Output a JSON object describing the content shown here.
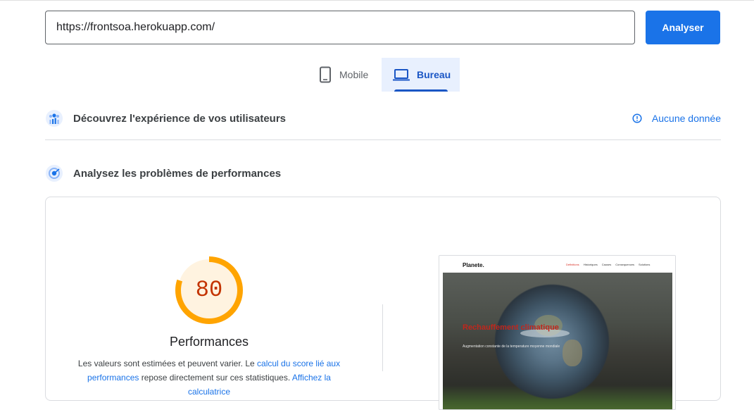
{
  "search": {
    "url_value": "https://frontsoa.herokuapp.com/",
    "analyze_label": "Analyser"
  },
  "tabs": [
    {
      "label": "Mobile",
      "icon": "smartphone-icon",
      "selected": false
    },
    {
      "label": "Bureau",
      "icon": "laptop-icon",
      "selected": true
    }
  ],
  "sections": {
    "field_data": {
      "title": "Découvrez l'expérience de vos utilisateurs",
      "icon": "users-data-icon",
      "status": "Aucune donnée",
      "status_icon": "info-icon"
    },
    "lab_data": {
      "title": "Analysez les problèmes de performances",
      "icon": "performance-diagnose-icon"
    }
  },
  "performance": {
    "score": "80",
    "score_fraction": 0.8,
    "label": "Performances",
    "desc_part1": "Les valeurs sont estimées et peuvent varier. Le ",
    "desc_link1": "calcul du score lié aux performances",
    "desc_part2": " repose directement sur ces statistiques. ",
    "desc_link2": "Affichez la calculatrice",
    "colors": {
      "ring": "#ffa400",
      "ring_bg": "#fff3e0",
      "score_text": "#c33300"
    }
  },
  "screenshot": {
    "site_logo": "Planete.",
    "nav_links": [
      "Definitions",
      "Historiques",
      "Causes",
      "Consequences",
      "Solutions"
    ],
    "hero_title": "Rechauffement climatique",
    "hero_subtitle": "Augmentation constante de la temperature moyenne mondiale"
  },
  "colors": {
    "accent": "#1a73e8",
    "tab_selected_bg": "#e8f0fe"
  }
}
